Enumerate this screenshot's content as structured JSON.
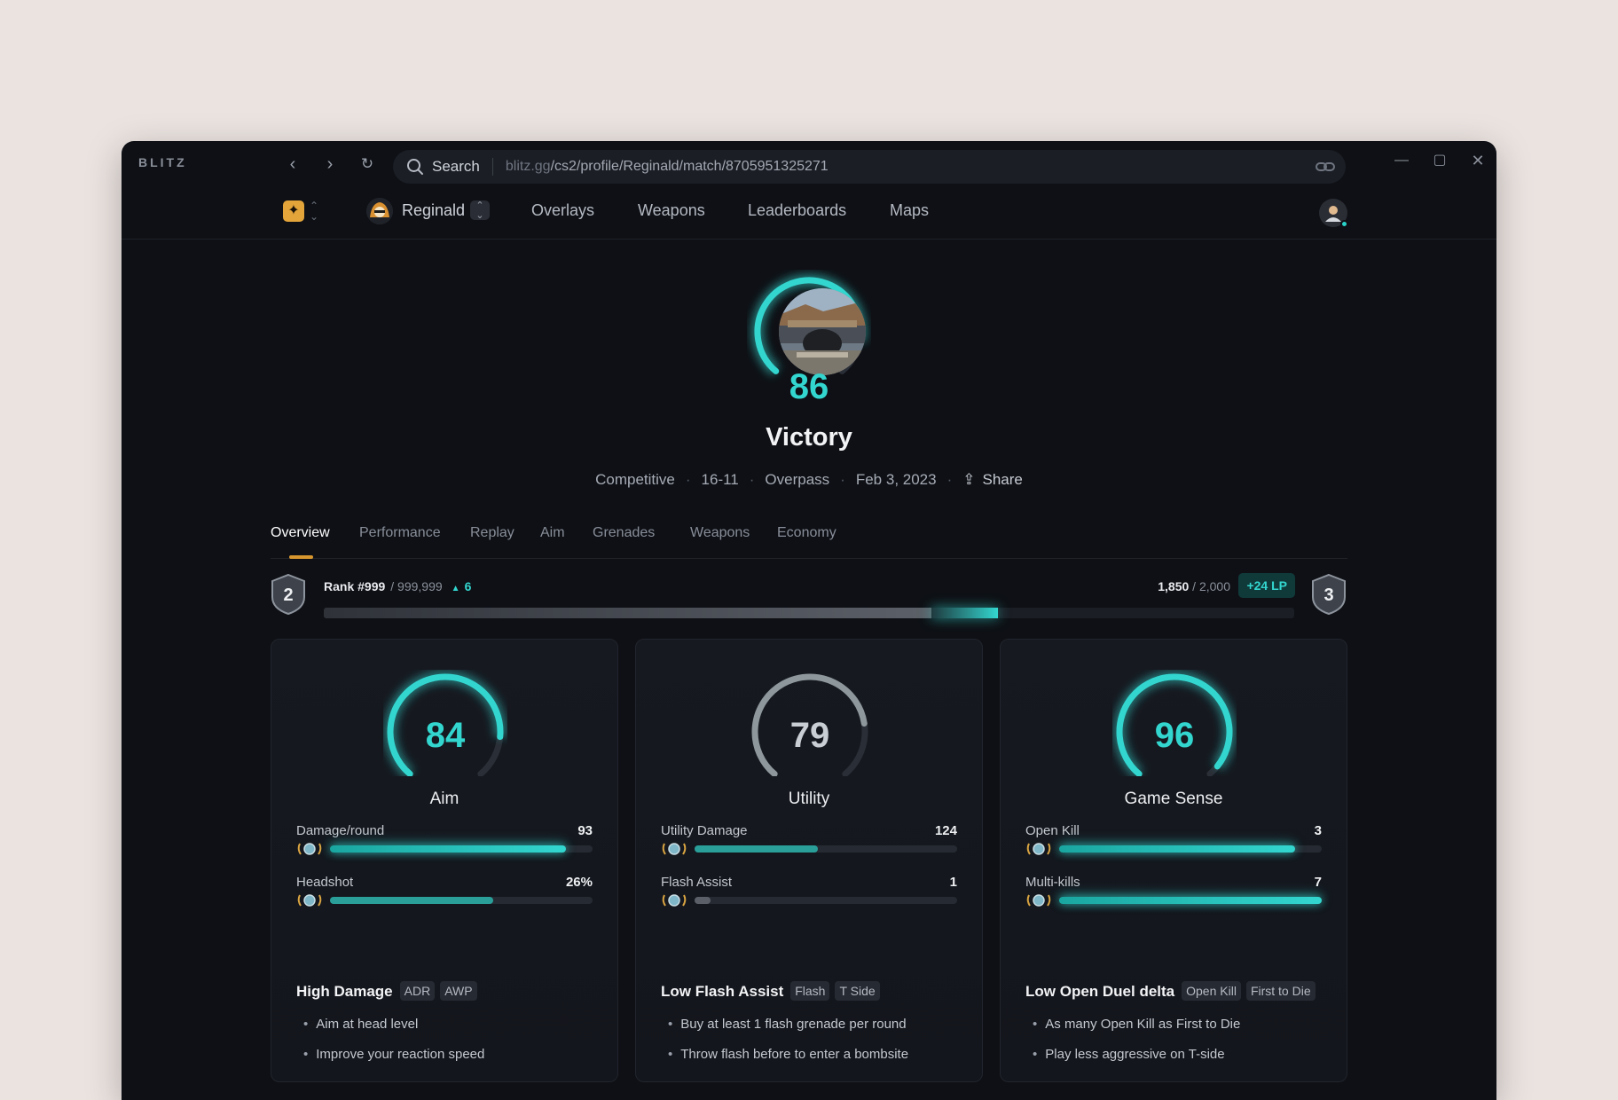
{
  "app": {
    "brand": "BLITZ",
    "search_label": "Search",
    "url_domain": "blitz.gg",
    "url_path": "/cs2/profile/Reginald/match/8705951325271"
  },
  "nav": {
    "profile_name": "Reginald",
    "links": [
      "Overlays",
      "Weapons",
      "Leaderboards",
      "Maps"
    ]
  },
  "match": {
    "score": "86",
    "score_fraction": 0.86,
    "result": "Victory",
    "mode": "Competitive",
    "rounds": "16-11",
    "map": "Overpass",
    "date": "Feb 3, 2023",
    "share_label": "Share"
  },
  "tabs": [
    "Overview",
    "Performance",
    "Replay",
    "Aim",
    "Grenades",
    "Weapons",
    "Economy"
  ],
  "rank": {
    "current_tier": "2",
    "next_tier": "3",
    "rank_label": "Rank #999",
    "rank_total": "/ 999,999",
    "rank_change": "6",
    "lp_current": "1,850",
    "lp_total": "/ 2,000",
    "lp_gain": "+24 LP",
    "progress_before": 0.626,
    "progress_after": 0.695
  },
  "cards": [
    {
      "score": "84",
      "fraction": 0.84,
      "title": "Aim",
      "stats": [
        {
          "name": "Damage/round",
          "value": "93",
          "fraction": 0.9,
          "style": "glow"
        },
        {
          "name": "Headshot",
          "value": "26%",
          "fraction": 0.62,
          "style": "mid"
        }
      ],
      "insight": "High Damage",
      "tags": [
        "ADR",
        "AWP"
      ],
      "tips": [
        "Aim at head level",
        "Improve your reaction speed"
      ]
    },
    {
      "score": "79",
      "fraction": 0.79,
      "title": "Utility",
      "stats": [
        {
          "name": "Utility Damage",
          "value": "124",
          "fraction": 0.47,
          "style": "mid"
        },
        {
          "name": "Flash Assist",
          "value": "1",
          "fraction": 0.06,
          "style": "low"
        }
      ],
      "insight": "Low Flash Assist",
      "tags": [
        "Flash",
        "T Side"
      ],
      "tips": [
        "Buy at least 1 flash grenade per round",
        "Throw flash before to enter a bombsite"
      ]
    },
    {
      "score": "96",
      "fraction": 0.96,
      "title": "Game Sense",
      "stats": [
        {
          "name": "Open Kill",
          "value": "3",
          "fraction": 0.9,
          "style": "glow"
        },
        {
          "name": "Multi-kills",
          "value": "7",
          "fraction": 1.0,
          "style": "glow"
        }
      ],
      "insight": "Low Open Duel delta",
      "tags": [
        "Open Kill",
        "First to Die"
      ],
      "tips": [
        "As many Open Kill as First to Die",
        "Play less aggressive on T-side"
      ]
    }
  ],
  "colors": {
    "accent": "#33d6cf",
    "gauge_gray": "#8d979c",
    "tab_indicator": "#d8962e"
  }
}
